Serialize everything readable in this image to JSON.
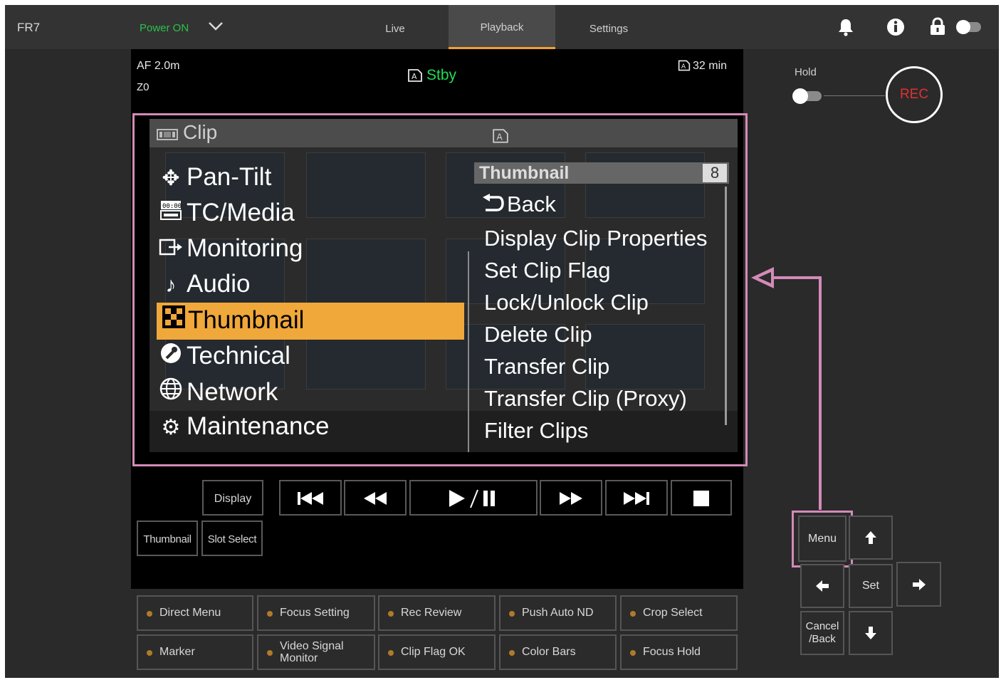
{
  "topbar": {
    "device": "FR7",
    "power": "Power ON",
    "tabs": [
      {
        "label": "Live"
      },
      {
        "label": "Playback"
      },
      {
        "label": "Settings"
      }
    ],
    "active_tab": "Playback"
  },
  "status": {
    "af": "AF 2.0m",
    "zoom": "Z0",
    "state": "Stby",
    "remaining": "32 min"
  },
  "menu": {
    "title": "Clip",
    "items": [
      {
        "label": "Pan-Tilt",
        "icon": "pan-tilt-icon"
      },
      {
        "label": "TC/Media",
        "icon": "tc-media-icon"
      },
      {
        "label": "Monitoring",
        "icon": "monitoring-icon"
      },
      {
        "label": "Audio",
        "icon": "audio-icon"
      },
      {
        "label": "Thumbnail",
        "icon": "thumbnail-icon"
      },
      {
        "label": "Technical",
        "icon": "technical-icon"
      },
      {
        "label": "Network",
        "icon": "network-icon"
      },
      {
        "label": "Maintenance",
        "icon": "maintenance-icon"
      }
    ],
    "selected": "Thumbnail",
    "submenu": {
      "title": "Thumbnail",
      "count": "8",
      "items": [
        "Back",
        "Display Clip Properties",
        "Set Clip Flag",
        "Lock/Unlock Clip",
        "Delete Clip",
        "Transfer Clip",
        "Transfer Clip (Proxy)",
        "Filter Clips"
      ]
    }
  },
  "playback": {
    "display": "Display",
    "thumbnail": "Thumbnail",
    "slot_select": "Slot Select"
  },
  "right_panel": {
    "hold_label": "Hold",
    "rec_label": "REC"
  },
  "nav": {
    "menu": "Menu",
    "set": "Set",
    "cancel_line1": "Cancel",
    "cancel_line2": "/Back"
  },
  "function_keys": {
    "row1": [
      "Direct Menu",
      "Focus Setting",
      "Rec Review",
      "Push Auto ND",
      "Crop Select"
    ],
    "row2": [
      "Marker",
      "Video Signal Monitor",
      "Clip Flag OK",
      "Color Bars",
      "Focus Hold"
    ]
  },
  "colors": {
    "accent": "#f0a030",
    "power_on": "#2bc24a",
    "stby": "#22dd55",
    "rec": "#e03030",
    "callout": "#d38bb8",
    "highlight": "#f0a83a"
  }
}
